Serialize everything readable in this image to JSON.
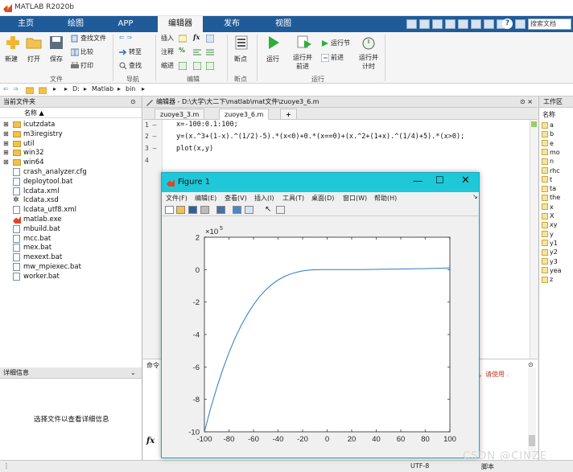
{
  "app": {
    "title": "MATLAB R2020b"
  },
  "tabs": [
    "主页",
    "绘图",
    "APP",
    "编辑器",
    "发布",
    "视图"
  ],
  "search_doc": "搜索文档",
  "ribbon": {
    "file_group": {
      "new": "新建",
      "open": "打开",
      "save": "保存",
      "find_file": "查找文件",
      "compare": "比较",
      "print": "打印",
      "label": "文件"
    },
    "nav_group": {
      "goto": "转至",
      "find": "查找",
      "label": "导航"
    },
    "edit_group": {
      "insert": "插入",
      "comment": "注释",
      "indent": "缩进",
      "fx": "fx",
      "label": "编辑"
    },
    "breakpoints_group": {
      "breakpoints": "断点",
      "label": "断点"
    },
    "run_group": {
      "run": "运行",
      "run_advance": "运行并\n前进",
      "run_section": "运行节",
      "advance": "前进",
      "run_time": "运行并\n计时",
      "label": "运行"
    }
  },
  "address": {
    "parts": [
      "D:",
      "Matlab",
      "bin"
    ]
  },
  "current_folder": {
    "header": "当前文件夹",
    "column": "名称 ▲",
    "items": [
      {
        "name": "icutzdata",
        "type": "folder"
      },
      {
        "name": "m3iregistry",
        "type": "folder"
      },
      {
        "name": "util",
        "type": "folder"
      },
      {
        "name": "win32",
        "type": "folder"
      },
      {
        "name": "win64",
        "type": "folder"
      },
      {
        "name": "crash_analyzer.cfg",
        "type": "file"
      },
      {
        "name": "deploytool.bat",
        "type": "file"
      },
      {
        "name": "lcdata.xml",
        "type": "file"
      },
      {
        "name": "lcdata.xsd",
        "type": "xsd"
      },
      {
        "name": "lcdata_utf8.xml",
        "type": "file"
      },
      {
        "name": "matlab.exe",
        "type": "exe"
      },
      {
        "name": "mbuild.bat",
        "type": "file"
      },
      {
        "name": "mcc.bat",
        "type": "file"
      },
      {
        "name": "mex.bat",
        "type": "file"
      },
      {
        "name": "mexext.bat",
        "type": "file"
      },
      {
        "name": "mw_mpiexec.bat",
        "type": "file"
      },
      {
        "name": "worker.bat",
        "type": "file"
      }
    ]
  },
  "details": {
    "header": "详细信息",
    "placeholder": "选择文件以查看详细信息"
  },
  "editor": {
    "header": "编辑器 - D:\\大学\\大二下\\matlab\\mat文件\\zuoye3_6.m",
    "tabs": [
      "zuoye3_3.m",
      "zuoye3_6.m"
    ],
    "add_tab": "+",
    "line_numbers": [
      "1 —",
      "2 —",
      "3 —",
      "4"
    ],
    "code": [
      "x=-100:0.1:100;",
      "y=(x.^3+(1-x).^(1/2)-5).*(x<0)+0.*(x==0)+(x.^2+(1+x).^(1/4)+5).*(x>0);",
      "plot(x,y)",
      ""
    ]
  },
  "command_window": {
    "header": "命令",
    "fx": "fx",
    "partial_text": "，请使用 ."
  },
  "workspace": {
    "header": "工作区",
    "column": "名称",
    "items": [
      "a",
      "b",
      "e",
      "mo",
      "n",
      "rhc",
      "t",
      "ta",
      "the",
      "x",
      "X",
      "xy",
      "y",
      "y1",
      "y2",
      "y3",
      "yea",
      "z"
    ]
  },
  "status": {
    "encoding": "UTF-8",
    "script": "脚本"
  },
  "figure": {
    "title": "Figure 1",
    "menu": [
      "文件(F)",
      "编辑(E)",
      "查看(V)",
      "插入(I)",
      "工具(T)",
      "桌面(D)",
      "窗口(W)",
      "帮助(H)"
    ],
    "exponent_label": "×10",
    "exponent_power": "5"
  },
  "chart_data": {
    "type": "line",
    "title": "",
    "xlabel": "",
    "ylabel": "",
    "xlim": [
      -100,
      100
    ],
    "ylim": [
      -10,
      2
    ],
    "y_scale_factor": "×10^5",
    "xticks": [
      -100,
      -80,
      -60,
      -40,
      -20,
      0,
      20,
      40,
      60,
      80,
      100
    ],
    "yticks": [
      -10,
      -8,
      -6,
      -4,
      -2,
      0,
      2
    ],
    "series": [
      {
        "color": "#2b7bc0",
        "x": [
          -100,
          -95,
          -90,
          -85,
          -80,
          -75,
          -70,
          -65,
          -60,
          -55,
          -50,
          -45,
          -40,
          -35,
          -30,
          -25,
          -20,
          -15,
          -10,
          -5,
          0,
          10,
          20,
          30,
          40,
          50,
          60,
          70,
          80,
          90,
          100
        ],
        "y": [
          -10.0,
          -8.57,
          -7.29,
          -6.14,
          -5.12,
          -4.22,
          -3.43,
          -2.75,
          -2.16,
          -1.66,
          -1.25,
          -0.91,
          -0.64,
          -0.43,
          -0.27,
          -0.16,
          -0.08,
          -0.03,
          -0.01,
          0.0,
          0.0,
          0.001,
          0.004,
          0.009,
          0.016,
          0.025,
          0.036,
          0.049,
          0.064,
          0.081,
          0.1
        ]
      }
    ]
  },
  "watermark": "CSDN @CINZE",
  "colors": {
    "tabbar": "#1f5b99",
    "figure_titlebar": "#1ec8d8",
    "line": "#2b7bc0"
  }
}
